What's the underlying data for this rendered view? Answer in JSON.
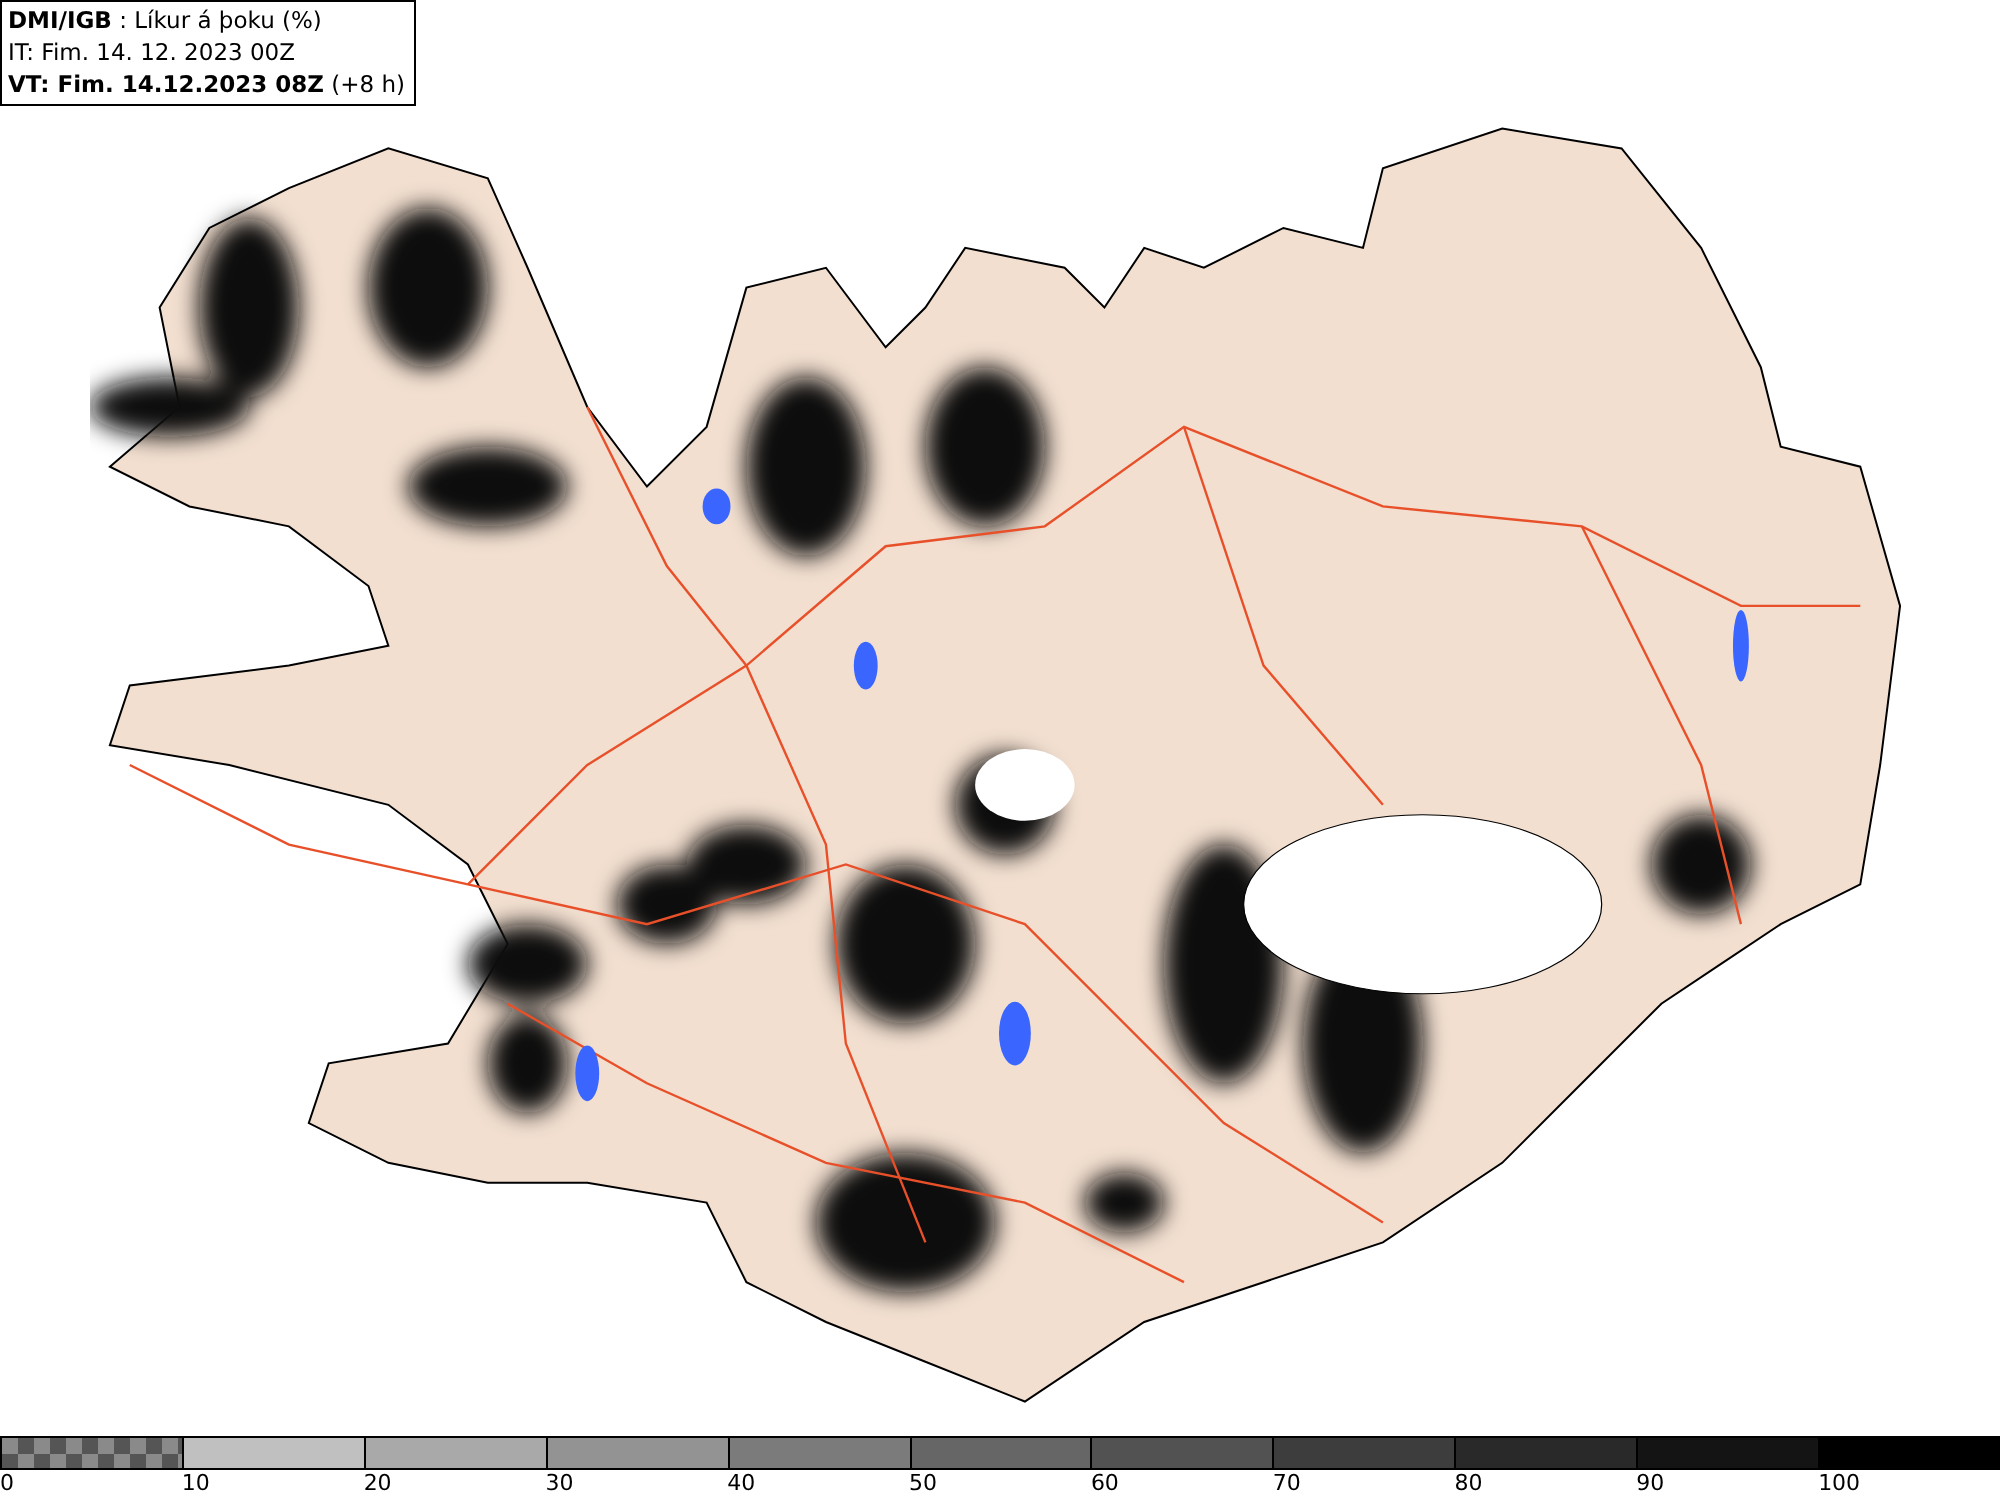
{
  "header": {
    "lines": [
      "**DMI/IGB** : Líkur á þoku (%)",
      "IT: Fim. 14. 12. 2023 00Z",
      "**VT: Fim. 14.12.2023 08Z** (+8 h)"
    ]
  },
  "legend": [
    {
      "label": "0",
      "kind": "checker"
    },
    {
      "label": "10",
      "kind": "solid",
      "color": "#c0c0c0"
    },
    {
      "label": "20",
      "kind": "solid",
      "color": "#a9a9a9"
    },
    {
      "label": "30",
      "kind": "solid",
      "color": "#939393"
    },
    {
      "label": "40",
      "kind": "solid",
      "color": "#7b7b7b"
    },
    {
      "label": "50",
      "kind": "solid",
      "color": "#666666"
    },
    {
      "label": "60",
      "kind": "solid",
      "color": "#525252"
    },
    {
      "label": "70",
      "kind": "solid",
      "color": "#3d3d3d"
    },
    {
      "label": "80",
      "kind": "solid",
      "color": "#292929"
    },
    {
      "label": "90",
      "kind": "solid",
      "color": "#141414"
    },
    {
      "label": "100",
      "kind": "solid",
      "color": "#000000"
    }
  ]
}
